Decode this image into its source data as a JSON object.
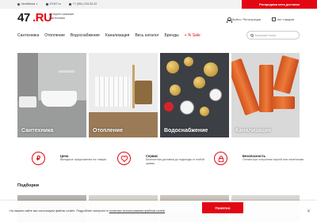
{
  "topbar": {
    "city": "Челябинск",
    "site": "47047.ru",
    "phone": "+7 (351) 219-22-22",
    "promo": "Распродажа мега доставки"
  },
  "header": {
    "logo_number": "47",
    "logo_ru": ".RU",
    "logo_tagline": "интернет-магазин сантехники",
    "auth_text": "Войти / Регистрация",
    "cart_text": "нет товаров"
  },
  "nav": {
    "items": [
      "Сантехника",
      "Отопление",
      "Водоснабжение",
      "Канализация",
      "Весь каталог",
      "Бренды"
    ],
    "sale": "+ % Sale"
  },
  "search": {
    "placeholder": "Быстрый поиск"
  },
  "tiles": [
    {
      "label": "Сантехника"
    },
    {
      "label": "Отопление"
    },
    {
      "label": "Водоснабжение"
    },
    {
      "label": "Канализация"
    }
  ],
  "features": [
    {
      "icon": "ruble-icon",
      "title": "Цена",
      "desc": "Выгодные предложения на товары"
    },
    {
      "icon": "heart-hands-icon",
      "title": "Сервис",
      "desc": "Бесплатная доставка до подъезда от любой суммы"
    },
    {
      "icon": "lock-icon",
      "title": "Безопасность",
      "desc": "Оплата при получении картой или наличными"
    }
  ],
  "section": {
    "title": "Подборки"
  },
  "cookie": {
    "text_before": "На нашем сайте мы используем файлы cookie. Подробнее смотрите в ",
    "link": "политике использования файлов cookie",
    "text_after": ".",
    "accept": "Понятно"
  },
  "colors": {
    "accent": "#e30613"
  }
}
